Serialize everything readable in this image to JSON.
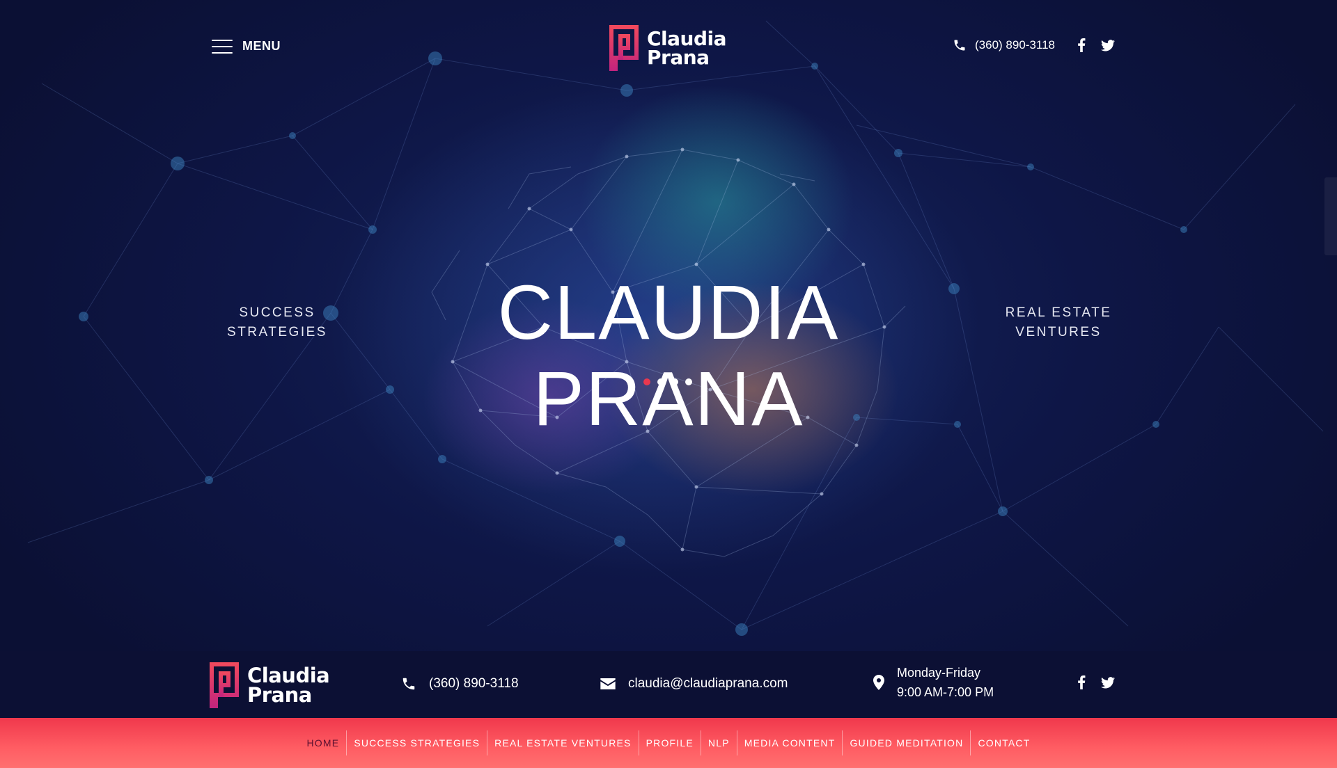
{
  "header": {
    "menu_label": "MENU",
    "logo_line1": "Claudia",
    "logo_line2": "Prana",
    "phone": "(360) 890-3118",
    "social_icons": [
      "facebook-icon",
      "twitter-icon"
    ]
  },
  "hero": {
    "title": "CLAUDIA PRANA",
    "left_line1": "SUCCESS",
    "left_line2": "STRATEGIES",
    "right_line1": "REAL ESTATE",
    "right_line2": "VENTURES",
    "slides": 4,
    "active_slide": 1
  },
  "info": {
    "logo_line1": "Claudia",
    "logo_line2": "Prana",
    "phone": "(360) 890-3118",
    "email": "claudia@claudiaprana.com",
    "hours_days": "Monday-Friday",
    "hours_time": "9:00 AM-7:00 PM"
  },
  "nav": {
    "items": [
      {
        "label": "HOME",
        "active": true
      },
      {
        "label": "SUCCESS STRATEGIES",
        "active": false
      },
      {
        "label": "REAL ESTATE VENTURES",
        "active": false
      },
      {
        "label": "PROFILE",
        "active": false
      },
      {
        "label": "NLP",
        "active": false
      },
      {
        "label": "MEDIA CONTENT",
        "active": false
      },
      {
        "label": "GUIDED MEDITATION",
        "active": false
      },
      {
        "label": "CONTACT",
        "active": false
      }
    ]
  },
  "colors": {
    "background": "#0b1034",
    "accent": "#e8384f",
    "nav_gradient_end": "#ff7070",
    "active_nav_text": "#5a1030"
  }
}
